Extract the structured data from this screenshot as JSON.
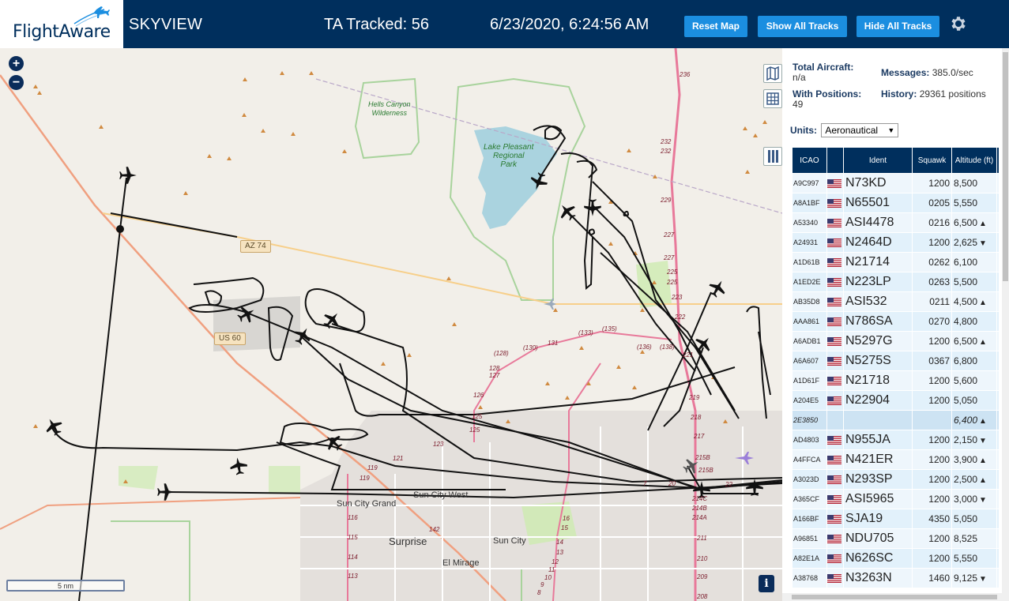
{
  "header": {
    "logo_text": "FlightAware",
    "app_title": "SKYVIEW",
    "ta_tracked": "TA Tracked: 56",
    "datetime": "6/23/2020, 6:24:56 AM",
    "reset_map_label": "Reset Map",
    "show_tracks_label": "Show All Tracks",
    "hide_tracks_label": "Hide All Tracks",
    "settings_icon": "gear-icon"
  },
  "map": {
    "zoom_in": "+",
    "zoom_out": "−",
    "scale_label": "5 nm",
    "info_label": "i",
    "labels": {
      "hells_canyon_1": "Hells Canyon",
      "hells_canyon_2": "Wilderness",
      "lake_1": "Lake Pleasant",
      "lake_2": "Regional",
      "lake_3": "Park",
      "sun_city_grand": "Sun City Grand",
      "sun_city_west": "Sun City West",
      "surprise": "Surprise",
      "sun_city": "Sun City",
      "el_mirage": "El Mirage",
      "az74": "AZ 74",
      "us60": "US 60"
    },
    "hwy_numbers": [
      "236",
      "232",
      "232",
      "229",
      "227",
      "227",
      "225",
      "225",
      "223",
      "222",
      "221",
      "219",
      "218",
      "217",
      "215B",
      "215B",
      "214C",
      "214B",
      "214A",
      "211",
      "210",
      "209",
      "208",
      "131",
      "(130)",
      "(128)",
      "128",
      "127",
      "(133)",
      "(135)",
      "(136)",
      "(138)",
      "126",
      "125",
      "125",
      "123",
      "121",
      "119",
      "119",
      "116",
      "115",
      "114",
      "113",
      "142",
      "16",
      "15",
      "14",
      "13",
      "12",
      "11",
      "10",
      "9",
      "8",
      "7",
      "20",
      "22",
      "5"
    ]
  },
  "sidebar": {
    "total_aircraft_label": "Total Aircraft:",
    "total_aircraft_value": "n/a",
    "messages_label": "Messages:",
    "messages_value": "385.0/sec",
    "with_positions_label": "With Positions:",
    "with_positions_value": "49",
    "history_label": "History:",
    "history_value": "29361 positions",
    "units_label": "Units:",
    "units_value": "Aeronautical",
    "columns": {
      "icao": "ICAO",
      "ident": "Ident",
      "squawk": "Squawk",
      "altitude": "Altitude (ft)"
    },
    "rows": [
      {
        "icao": "A9C997",
        "ident": "N73KD",
        "squawk": "1200",
        "alt": "8,500",
        "trend": ""
      },
      {
        "icao": "A8A1BF",
        "ident": "N65501",
        "squawk": "0205",
        "alt": "5,550",
        "trend": ""
      },
      {
        "icao": "A53340",
        "ident": "ASI4478",
        "squawk": "0216",
        "alt": "6,500",
        "trend": "▲"
      },
      {
        "icao": "A24931",
        "ident": "N2464D",
        "squawk": "1200",
        "alt": "2,625",
        "trend": "▼"
      },
      {
        "icao": "A1D61B",
        "ident": "N21714",
        "squawk": "0262",
        "alt": "6,100",
        "trend": ""
      },
      {
        "icao": "A1ED2E",
        "ident": "N223LP",
        "squawk": "0263",
        "alt": "5,500",
        "trend": ""
      },
      {
        "icao": "AB35D8",
        "ident": "ASI532",
        "squawk": "0211",
        "alt": "4,500",
        "trend": "▲"
      },
      {
        "icao": "AAA861",
        "ident": "N786SA",
        "squawk": "0270",
        "alt": "4,800",
        "trend": ""
      },
      {
        "icao": "A6ADB1",
        "ident": "N5297G",
        "squawk": "1200",
        "alt": "6,500",
        "trend": "▲"
      },
      {
        "icao": "A6A607",
        "ident": "N5275S",
        "squawk": "0367",
        "alt": "6,800",
        "trend": ""
      },
      {
        "icao": "A1D61F",
        "ident": "N21718",
        "squawk": "1200",
        "alt": "5,600",
        "trend": ""
      },
      {
        "icao": "A204E5",
        "ident": "N22904",
        "squawk": "1200",
        "alt": "5,050",
        "trend": ""
      },
      {
        "icao": "2E3850",
        "ident": "",
        "squawk": "",
        "alt": "6,400",
        "trend": "▲",
        "selected": true
      },
      {
        "icao": "AD4803",
        "ident": "N955JA",
        "squawk": "1200",
        "alt": "2,150",
        "trend": "▼"
      },
      {
        "icao": "A4FFCA",
        "ident": "N421ER",
        "squawk": "1200",
        "alt": "3,900",
        "trend": "▲"
      },
      {
        "icao": "A3023D",
        "ident": "N293SP",
        "squawk": "1200",
        "alt": "2,500",
        "trend": "▲"
      },
      {
        "icao": "A365CF",
        "ident": "ASI5965",
        "squawk": "1200",
        "alt": "3,000",
        "trend": "▼"
      },
      {
        "icao": "A166BF",
        "ident": "SJA19",
        "squawk": "4350",
        "alt": "5,050",
        "trend": ""
      },
      {
        "icao": "A96851",
        "ident": "NDU705",
        "squawk": "1200",
        "alt": "8,525",
        "trend": ""
      },
      {
        "icao": "A82E1A",
        "ident": "N626SC",
        "squawk": "1200",
        "alt": "5,550",
        "trend": ""
      },
      {
        "icao": "A38768",
        "ident": "N3263N",
        "squawk": "1460",
        "alt": "9,125",
        "trend": "▼"
      }
    ]
  }
}
